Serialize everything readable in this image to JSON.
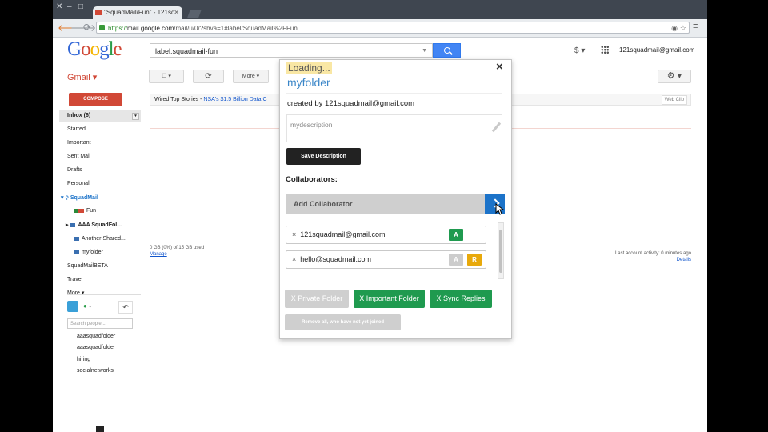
{
  "browser": {
    "tab_title": "\"SquadMail/Fun\" - 121sq",
    "url_scheme": "https://",
    "url_host": "mail.google.com",
    "url_rest": "/mail/u/0/?shva=1#label/SquadMail%2FFun"
  },
  "header": {
    "logo_letters": [
      "G",
      "o",
      "o",
      "g",
      "l",
      "e"
    ],
    "search_value": "label:squadmail-fun",
    "account": "121squadmail@gmail.com",
    "dollar": "$"
  },
  "toolbar": {
    "gmail_label": "Gmail ▾",
    "refresh": "⟳",
    "more": "More ▾"
  },
  "sidebar": {
    "compose": "COMPOSE",
    "inbox": "Inbox (6)",
    "items": [
      "Starred",
      "Important",
      "Sent Mail",
      "Drafts",
      "Personal"
    ],
    "squadmail": "SquadMail",
    "sub_items": [
      "Fun",
      "AAA SquadFol...",
      "Another Shared...",
      "myfolder"
    ],
    "after_items": [
      "SquadMailBETA",
      "Travel",
      "More ▾"
    ],
    "people_search": "Search people...",
    "contacts": [
      "aaasquadfolder",
      "aaasquadfolder",
      "hiring",
      "socialnetworks"
    ]
  },
  "main": {
    "webclip_source": "Wired Top Stories -",
    "webclip_link": "NSA's $1.5 Billion Data C",
    "webclip_tag": "Web Clip",
    "storage_line1": "0 GB (0%) of 15 GB used",
    "storage_line2": "Manage",
    "activity_line1": "Last account activity: 0 minutes ago",
    "activity_line2": "Details"
  },
  "popup": {
    "loading": "Loading...",
    "close": "×",
    "folder_name": "myfolder",
    "created_by": "created by 121squadmail@gmail.com",
    "description_placeholder": "mydescription",
    "save_description": "Save Description",
    "collaborators_title": "Collaborators:",
    "add_collaborator": "Add Collaborator",
    "collaborators": [
      {
        "remove": "×",
        "email": "121squadmail@gmail.com",
        "badges": [
          {
            "text": "A",
            "color": "#1f9a4f"
          }
        ]
      },
      {
        "remove": "×",
        "email": "hello@squadmail.com",
        "badges": [
          {
            "text": "A",
            "color": "#cccccc"
          },
          {
            "text": "R",
            "color": "#e8a90b"
          }
        ]
      }
    ],
    "private_folder": "X Private Folder",
    "important_folder": "X Important Folder",
    "sync_replies": "X Sync Replies",
    "remove_all": "Remove all, who have not yet joined"
  },
  "colors": {
    "accent_blue": "#1c73c9",
    "green": "#1f9a4f",
    "gmail_red": "#d14836",
    "disabled_gray": "#cfcfcf"
  }
}
